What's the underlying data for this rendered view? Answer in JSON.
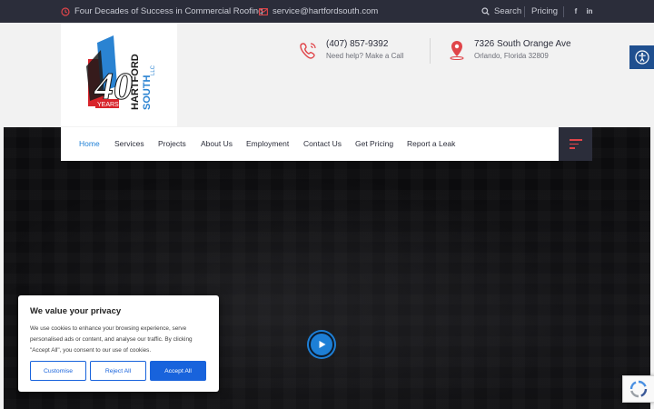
{
  "topbar": {
    "tagline": "Four Decades of Success in Commercial Roofing",
    "email": "service@hartfordsouth.com",
    "search_label": "Search",
    "pricing_label": "Pricing",
    "social": [
      "f",
      "in"
    ]
  },
  "logo": {
    "years_label": "YEARS",
    "number": "40",
    "name_line1": "HARTFORD",
    "name_line2": "SOUTH",
    "suffix": "LLC"
  },
  "contact": {
    "phone": "(407) 857-9392",
    "phone_sub": "Need help? Make a Call",
    "address": "7326 South Orange Ave",
    "address_sub": "Orlando, Florida 32809"
  },
  "nav": {
    "items": [
      "Home",
      "Services",
      "Projects",
      "About Us",
      "Employment",
      "Contact Us",
      "Get Pricing",
      "Report a Leak"
    ],
    "active_index": 0
  },
  "cookie": {
    "title": "We value your privacy",
    "body": "We use cookies to enhance your browsing experience, serve personalised ads or content, and analyse our traffic. By clicking \"Accept All\", you consent to our use of cookies.",
    "customise_label": "Customise",
    "reject_label": "Reject All",
    "accept_label": "Accept All"
  },
  "colors": {
    "accent_red": "#e0454a",
    "accent_blue": "#1d7fd6",
    "topbar_bg": "#2b2d3a",
    "cookie_blue": "#1863dc"
  },
  "icons": {
    "tagline": "clock-icon",
    "email": "envelope-icon",
    "search": "search-icon",
    "phone": "phone-icon",
    "address": "map-pin-icon",
    "accessibility": "accessibility-icon",
    "menu": "hamburger-menu-icon",
    "play": "play-icon",
    "recaptcha": "recaptcha-icon"
  }
}
